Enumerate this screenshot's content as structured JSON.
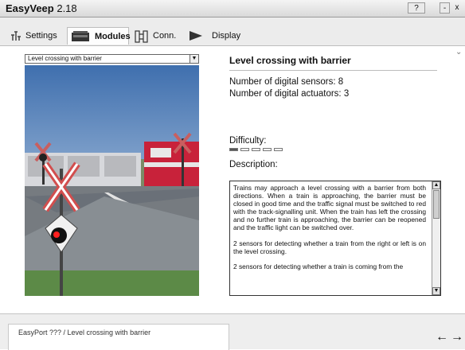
{
  "window": {
    "title": "EasyVeep",
    "version": "2.18",
    "help_label": "?",
    "minimize_label": "-",
    "close_label": "x"
  },
  "tabs": [
    {
      "label": "Settings",
      "icon": "settings-icon"
    },
    {
      "label": "Modules",
      "icon": "modules-icon",
      "selected": true
    },
    {
      "label": "Conn.",
      "icon": "connection-icon"
    },
    {
      "label": "Display",
      "icon": "display-icon"
    }
  ],
  "module": {
    "selected": "Level crossing with barrier",
    "title": "Level crossing with barrier",
    "sensors": "Number of digital sensors: 8",
    "actuators": "Number of digital actuators: 3",
    "difficulty_label": "Difficulty:",
    "difficulty_level": 1,
    "difficulty_max": 5,
    "description_label": "Description:",
    "description": [
      "Trains may approach a level crossing with a barrier from both directions. When a train is approaching, the barrier must be closed in good time and the traffic signal must be switched to red with the track-signalling unit. When the train has left the crossing and no further train is approaching, the barrier can be reopened and the traffic light can be switched over.",
      "2 sensors for detecting whether a train from the right or left is on the level crossing.",
      "2 sensors for detecting whether a train is coming from the"
    ]
  },
  "status": {
    "text": "EasyPort ???  / Level crossing with barrier"
  },
  "nav": {
    "back": "←",
    "forward": "→"
  }
}
